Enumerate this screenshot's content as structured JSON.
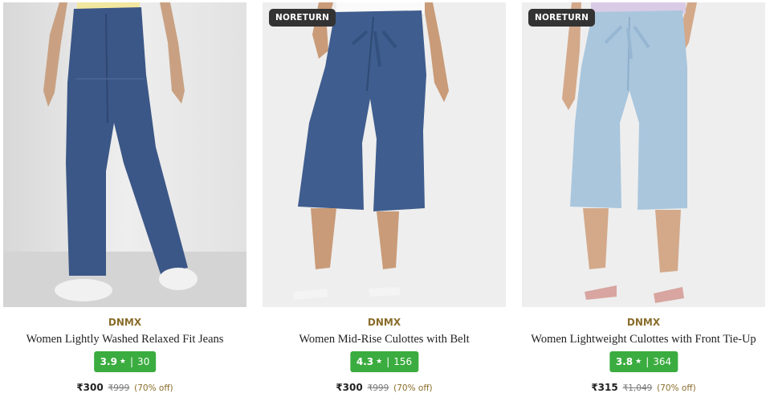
{
  "products": [
    {
      "tag": "",
      "brand": "DNMX",
      "name": "Women Lightly Washed Relaxed Fit Jeans",
      "rating": "3.9",
      "rating_separator": "|",
      "rating_count": "30",
      "price": "₹300",
      "mrp": "₹999",
      "discount": "(70% off)",
      "colors": {
        "denim": "#3b5787",
        "bg": "#e4e4e4"
      }
    },
    {
      "tag": "NORETURN",
      "brand": "DNMX",
      "name": "Women Mid-Rise Culottes with Belt",
      "rating": "4.3",
      "rating_separator": "|",
      "rating_count": "156",
      "price": "₹300",
      "mrp": "₹999",
      "discount": "(70% off)",
      "colors": {
        "denim": "#3f5d8e",
        "bg": "#eeeeee"
      }
    },
    {
      "tag": "NORETURN",
      "brand": "DNMX",
      "name": "Women Lightweight Culottes with Front Tie-Up",
      "rating": "3.8",
      "rating_separator": "|",
      "rating_count": "364",
      "price": "₹315",
      "mrp": "₹1,049",
      "discount": "(70% off)",
      "colors": {
        "denim": "#a9c6dd",
        "bg": "#eeeeee"
      }
    }
  ],
  "icons": {
    "rating_star": "star-icon"
  },
  "colors": {
    "brand": "#8a6d2b",
    "rating_badge": "#3bac3f",
    "tag_bg": "#333333"
  }
}
